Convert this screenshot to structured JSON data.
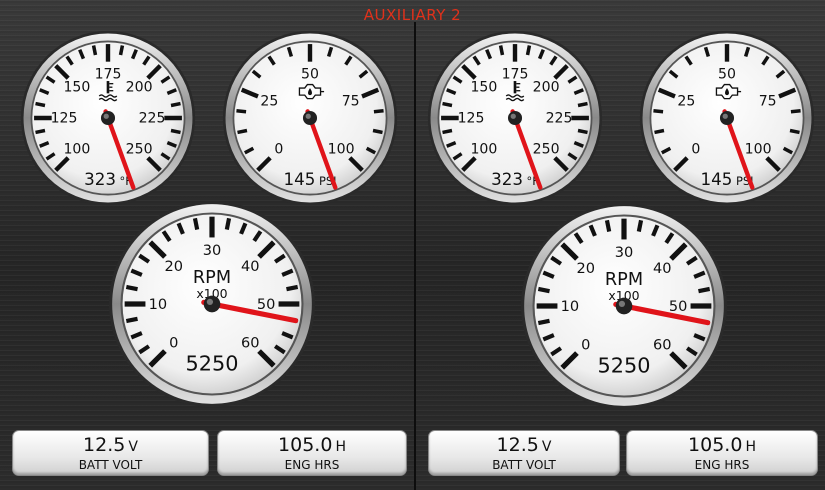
{
  "screen_title": "AUXILIARY 2",
  "colors": {
    "title": "#e0311b",
    "needle": "#e0141a"
  },
  "panels": [
    {
      "temp_gauge": {
        "icon": "coolant-temp-icon",
        "ticks": [
          "100",
          "125",
          "150",
          "175",
          "200",
          "225",
          "250"
        ],
        "min": 100,
        "max": 250,
        "value": 323,
        "readout": "323",
        "unit": "°F"
      },
      "pressure_gauge": {
        "icon": "oil-pressure-icon",
        "ticks": [
          "0",
          "25",
          "50",
          "75",
          "100"
        ],
        "min": 0,
        "max": 100,
        "value": 145,
        "readout": "145",
        "unit": "PSI"
      },
      "rpm_gauge": {
        "title": "RPM",
        "subtitle": "x100",
        "ticks": [
          "0",
          "10",
          "20",
          "30",
          "40",
          "50",
          "60"
        ],
        "min": 0,
        "max": 60,
        "value": 52.5,
        "readout": "5250"
      },
      "battery": {
        "value": "12.5",
        "unit": "V",
        "label": "BATT VOLT"
      },
      "engine_hours": {
        "value": "105.0",
        "unit": "H",
        "label": "ENG HRS"
      }
    },
    {
      "temp_gauge": {
        "icon": "coolant-temp-icon",
        "ticks": [
          "100",
          "125",
          "150",
          "175",
          "200",
          "225",
          "250"
        ],
        "min": 100,
        "max": 250,
        "value": 323,
        "readout": "323",
        "unit": "°F"
      },
      "pressure_gauge": {
        "icon": "oil-pressure-icon",
        "ticks": [
          "0",
          "25",
          "50",
          "75",
          "100"
        ],
        "min": 0,
        "max": 100,
        "value": 145,
        "readout": "145",
        "unit": "PSI"
      },
      "rpm_gauge": {
        "title": "RPM",
        "subtitle": "x100",
        "ticks": [
          "0",
          "10",
          "20",
          "30",
          "40",
          "50",
          "60"
        ],
        "min": 0,
        "max": 60,
        "value": 52.5,
        "readout": "5250"
      },
      "battery": {
        "value": "12.5",
        "unit": "V",
        "label": "BATT VOLT"
      },
      "engine_hours": {
        "value": "105.0",
        "unit": "H",
        "label": "ENG HRS"
      }
    }
  ]
}
